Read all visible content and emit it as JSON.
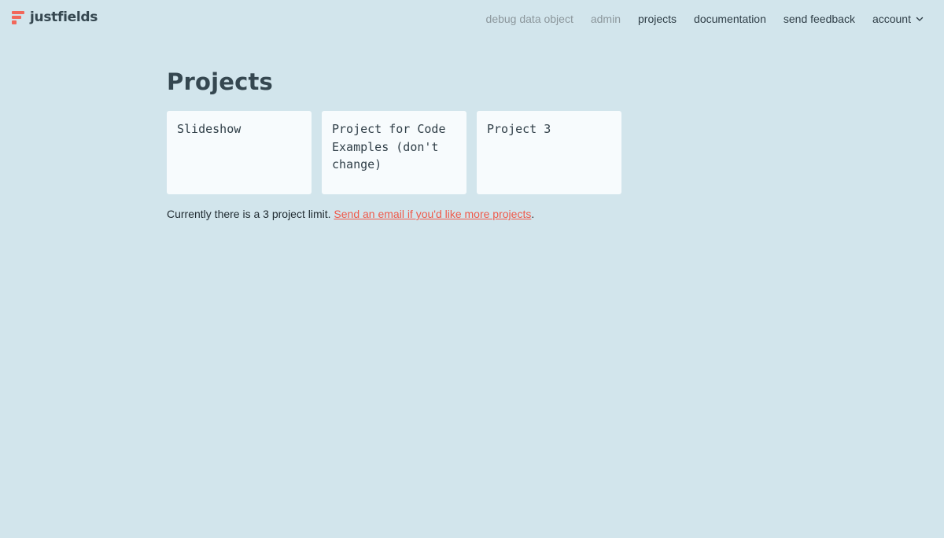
{
  "brand": {
    "name": "justfields"
  },
  "nav": {
    "items": [
      {
        "label": "debug data object"
      },
      {
        "label": "admin"
      },
      {
        "label": "projects"
      },
      {
        "label": "documentation"
      },
      {
        "label": "send feedback"
      },
      {
        "label": "account"
      }
    ]
  },
  "page": {
    "title": "Projects"
  },
  "projects": [
    {
      "name": "Slideshow"
    },
    {
      "name": "Project for Code Examples (don't change)"
    },
    {
      "name": "Project 3"
    }
  ],
  "limit_note": {
    "text": "Currently there is a 3 project limit.",
    "link": "Send an email if you'd like more projects",
    "suffix": "."
  },
  "colors": {
    "background": "#d2e5ec",
    "card": "#f7fbfd",
    "accent": "#f0594a",
    "heading": "#354750"
  }
}
